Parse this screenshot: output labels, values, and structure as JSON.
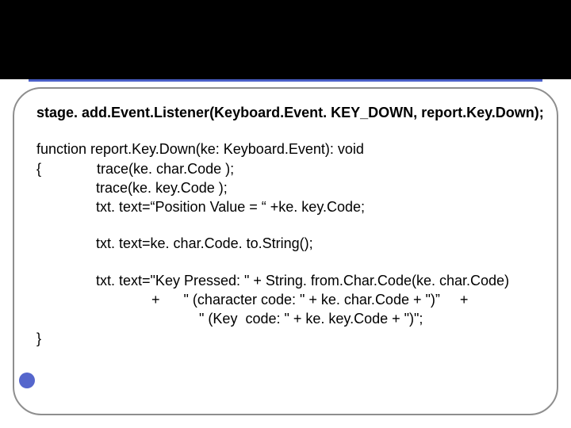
{
  "code": {
    "l1": "stage. add.Event.Listener(Keyboard.Event. KEY_DOWN, report.Key.Down);",
    "l2": "function report.Key.Down(ke: Keyboard.Event): void",
    "l3": "{              trace(ke. char.Code );",
    "l4": "               trace(ke. key.Code );",
    "l5": "               txt. text=“Position Value = “ +ke. key.Code;",
    "l6": "               txt. text=ke. char.Code. to.String();",
    "l7": "               txt. text=\"Key Pressed: \" + String. from.Char.Code(ke. char.Code)",
    "l8": "                             +      \" (character code: \" + ke. char.Code + \")”     +",
    "l9": "                                         \" (Key  code: \" + ke. key.Code + \")\";",
    "l10": "}"
  }
}
